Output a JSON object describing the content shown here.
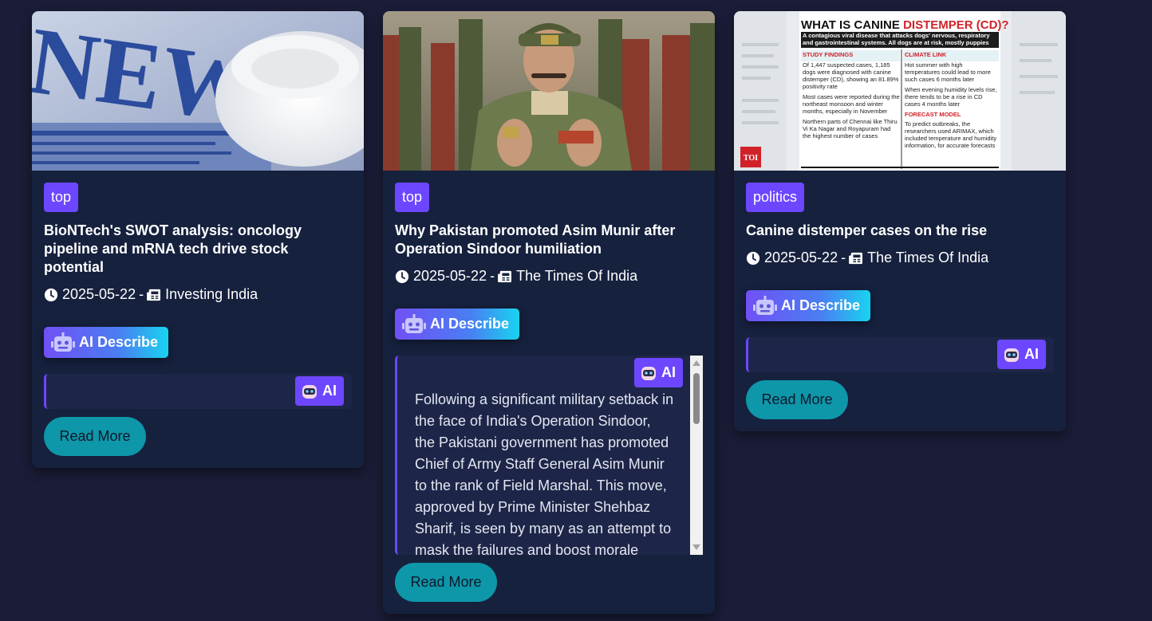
{
  "colors": {
    "page_bg": "#1b1d38",
    "card_bg": "#16213e",
    "badge": "#6c47ff",
    "read_more": "#0e97a8",
    "ai_gradient_start": "#7050f5",
    "ai_gradient_end": "#18d4ef"
  },
  "articles": [
    {
      "category": "top",
      "title": "BioNTech's SWOT analysis: oncology pipeline and mRNA tech drive stock potential",
      "date": "2025-05-22",
      "separator": "-",
      "source": "Investing India",
      "ai_describe_label": "AI Describe",
      "ai_tag_label": "AI",
      "ai_text": "",
      "read_more_label": "Read More",
      "image_icon": "news-newspaper-photo"
    },
    {
      "category": "top",
      "title": "Why Pakistan promoted Asim Munir after Operation Sindoor humiliation",
      "date": "2025-05-22",
      "separator": "-",
      "source": "The Times Of India",
      "ai_describe_label": "AI Describe",
      "ai_tag_label": "AI",
      "ai_text": "Following a significant military setback in the face of India's Operation Sindoor, the Pakistani government has promoted Chief of Army Staff General Asim Munir to the rank of Field Marshal. This move, approved by Prime Minister Shehbaz Sharif, is seen by many as an attempt to mask the failures and boost morale",
      "read_more_label": "Read More",
      "image_icon": "army-officer-photo"
    },
    {
      "category": "politics",
      "title": "Canine distemper cases on the rise",
      "date": "2025-05-22",
      "separator": "-",
      "source": "The Times Of India",
      "ai_describe_label": "AI Describe",
      "ai_tag_label": "AI",
      "ai_text": "",
      "read_more_label": "Read More",
      "image_icon": "infographic-photo",
      "infographic": {
        "heading_a": "WHAT IS CANINE ",
        "heading_b": "DISTEMPER (CD)?",
        "banner": "A contagious viral disease that attacks dogs' nervous, respiratory and gastrointestinal systems. All dogs are at risk, mostly puppies",
        "left_title": "STUDY FINDINGS",
        "left_items": [
          "Of 1,447 suspected cases, 1,185 dogs were diagnosed with canine distemper (CD), showing an 81.89% positivity rate",
          "Most cases were reported during the northeast monsoon and winter months, especially in November",
          "Northern parts of Chennai like Thiru Vi Ka Nagar and Royapuram had the highest number of cases"
        ],
        "right_title": "CLIMATE LINK",
        "right_items": [
          "Hot summer with high temperatures could lead to more such cases 6 months later",
          "When evening humidity levels rise, there tends to be a rise in CD cases 4 months later"
        ],
        "right_title_2": "FORECAST MODEL",
        "right_items_2": [
          "To predict outbreaks, the researchers used ARIMAX, which included temperature and humidity information, for accurate forecasts"
        ],
        "logo": "TOI"
      }
    }
  ]
}
